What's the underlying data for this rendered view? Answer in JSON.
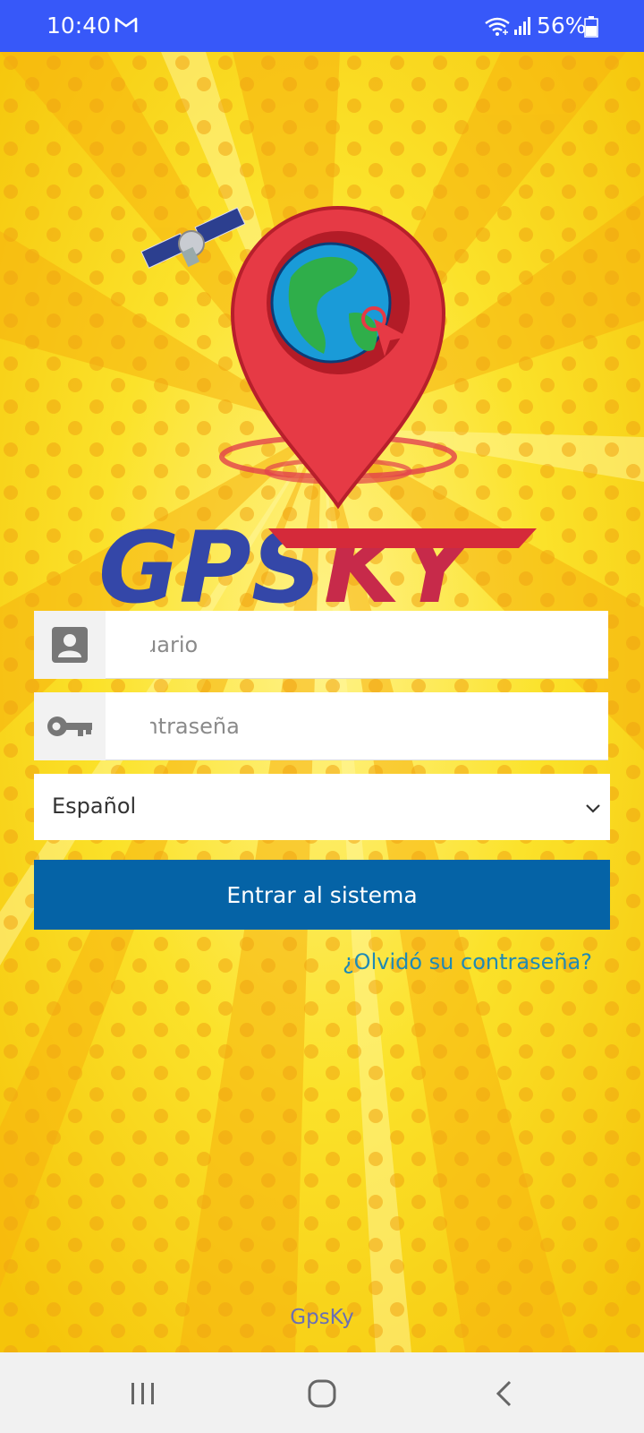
{
  "status_bar": {
    "time": "10:40",
    "battery": "56%",
    "icons": [
      "gmail-icon",
      "wifi-icon",
      "signal-icon",
      "battery-icon"
    ]
  },
  "form": {
    "username_placeholder": "Usuario",
    "password_placeholder": "Contraseña",
    "language_value": "Español",
    "submit_label": "Entrar al sistema",
    "forgot_password_label": "¿Olvidó su contraseña?"
  },
  "footer": {
    "brand": "GpsKy"
  },
  "logo": {
    "wordmark": "GPSKY"
  },
  "colors": {
    "status_bar": "#3758f9",
    "background": "#f6d40c",
    "button": "#0563a6",
    "link": "#1f8ab5",
    "footer_text": "#6a6fb4"
  },
  "nav": {
    "icons": [
      "recent-apps-icon",
      "home-icon",
      "back-icon"
    ]
  }
}
